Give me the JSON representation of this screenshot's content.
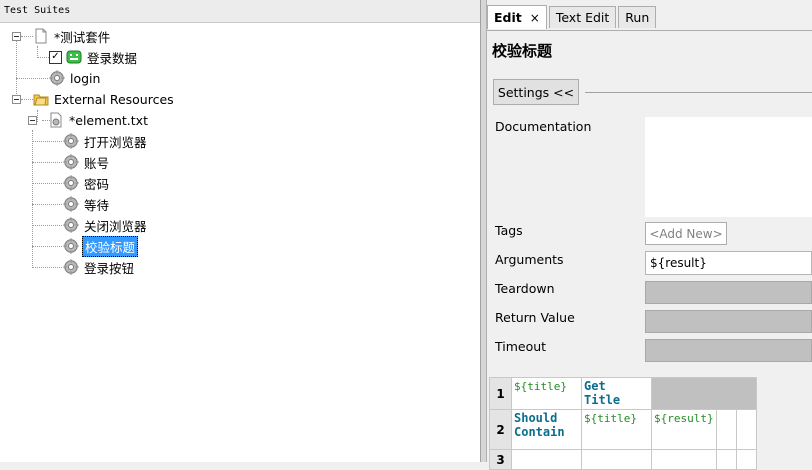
{
  "left_panel": {
    "title": "Test Suites",
    "tree": {
      "suite": "*测试套件",
      "test_case": "登录数据",
      "login": "login",
      "external_resources": "External Resources",
      "resource_file": "*element.txt",
      "keywords": [
        "打开浏览器",
        "账号",
        "密码",
        "等待",
        "关闭浏览器",
        "校验标题",
        "登录按钮"
      ],
      "selected_keyword": "校验标题"
    }
  },
  "right_panel": {
    "tabs": [
      {
        "label": "Edit",
        "close": "×"
      },
      {
        "label": "Text Edit"
      },
      {
        "label": "Run"
      }
    ],
    "keyword_title": "校验标题",
    "settings_button": "Settings <<",
    "labels": {
      "documentation": "Documentation",
      "tags": "Tags",
      "arguments": "Arguments",
      "teardown": "Teardown",
      "return_value": "Return Value",
      "timeout": "Timeout"
    },
    "tags_add_new": "<Add New>",
    "arguments_value": "${result}",
    "grid": {
      "row_numbers": [
        "1",
        "2",
        "3"
      ],
      "rows": [
        [
          "${title}",
          "Get Title",
          "",
          ""
        ],
        [
          "Should Contain",
          "${title}",
          "${result}",
          ""
        ]
      ]
    }
  }
}
